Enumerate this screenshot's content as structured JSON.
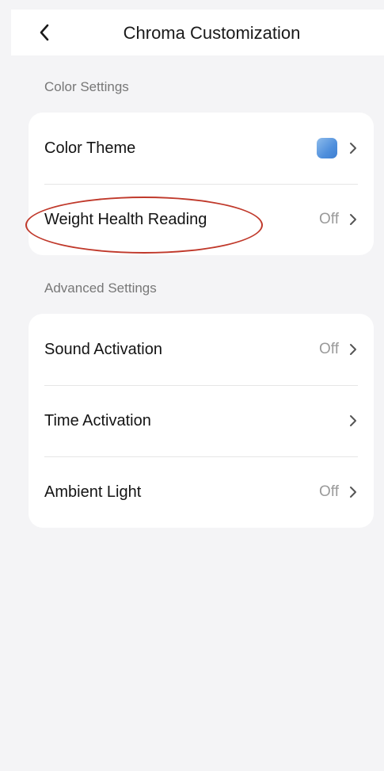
{
  "header": {
    "title": "Chroma Customization",
    "back_icon": "chevron-left-icon"
  },
  "sections": {
    "color": {
      "label": "Color Settings",
      "items": [
        {
          "label": "Color Theme",
          "value": "",
          "swatch_color": "#4f8fdc"
        },
        {
          "label": "Weight Health Reading",
          "value": "Off"
        }
      ]
    },
    "advanced": {
      "label": "Advanced Settings",
      "items": [
        {
          "label": "Sound Activation",
          "value": "Off"
        },
        {
          "label": "Time Activation",
          "value": ""
        },
        {
          "label": "Ambient Light",
          "value": "Off"
        }
      ]
    }
  },
  "colors": {
    "background": "#f4f4f6",
    "card": "#ffffff",
    "annotation": "#c0392b"
  }
}
